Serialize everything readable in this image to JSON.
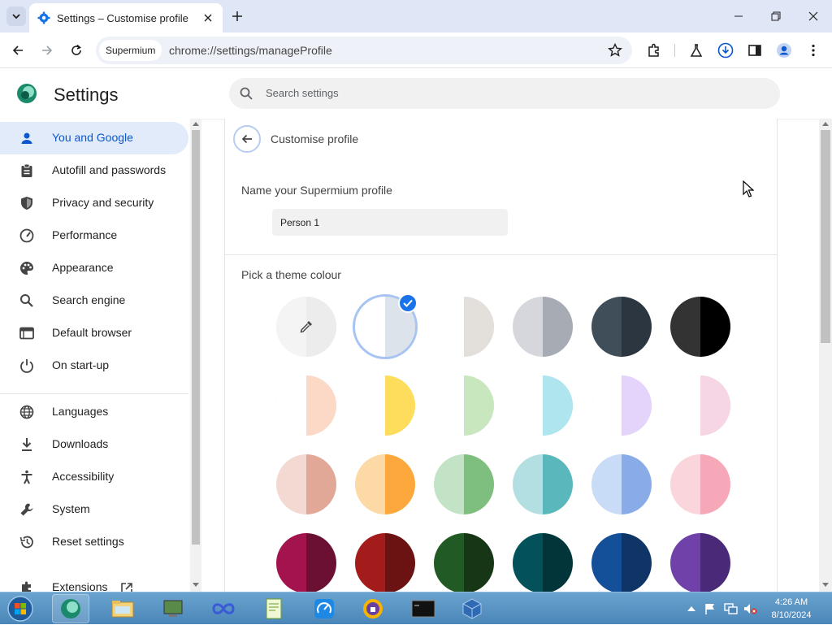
{
  "browser": {
    "tab": {
      "title": "Settings – Customise profile"
    },
    "omnibox": {
      "chip": "Supermium",
      "url": "chrome://settings/manageProfile"
    }
  },
  "header": {
    "title": "Settings",
    "search_placeholder": "Search settings"
  },
  "sidebar": {
    "items": [
      {
        "label": "You and Google",
        "icon": "person-icon",
        "active": true
      },
      {
        "label": "Autofill and passwords",
        "icon": "clipboard-icon"
      },
      {
        "label": "Privacy and security",
        "icon": "shield-icon"
      },
      {
        "label": "Performance",
        "icon": "speedometer-icon"
      },
      {
        "label": "Appearance",
        "icon": "palette-icon"
      },
      {
        "label": "Search engine",
        "icon": "search-icon"
      },
      {
        "label": "Default browser",
        "icon": "browser-icon"
      },
      {
        "label": "On start-up",
        "icon": "power-icon"
      },
      {
        "label": "Languages",
        "icon": "globe-icon"
      },
      {
        "label": "Downloads",
        "icon": "download-icon"
      },
      {
        "label": "Accessibility",
        "icon": "accessibility-icon"
      },
      {
        "label": "System",
        "icon": "wrench-icon"
      },
      {
        "label": "Reset settings",
        "icon": "history-icon"
      },
      {
        "label": "Extensions",
        "icon": "puzzle-icon"
      }
    ]
  },
  "page": {
    "title": "Customise profile",
    "name_label": "Name your Supermium profile",
    "name_value": "Person 1",
    "theme_label": "Pick a theme colour",
    "selected_swatch": 1,
    "swatches": [
      {
        "l": "#f4f4f4",
        "r": "#ececec",
        "light": true,
        "picker": true
      },
      {
        "l": "#ffffff",
        "r": "#dde3ea",
        "light": true
      },
      {
        "l": "#ffffff",
        "r": "#e3dfda",
        "light": true
      },
      {
        "l": "#d5d7dc",
        "r": "#a7abb3"
      },
      {
        "l": "#3f4e59",
        "r": "#2c3640"
      },
      {
        "l": "#333333",
        "r": "#000000"
      },
      {
        "l": "#ffffff",
        "r": "#fcd9c6",
        "light": true
      },
      {
        "l": "#ffffff",
        "r": "#fedd5c",
        "light": true
      },
      {
        "l": "#ffffff",
        "r": "#c9e7be",
        "light": true
      },
      {
        "l": "#ffffff",
        "r": "#aee5ef",
        "light": true
      },
      {
        "l": "#ffffff",
        "r": "#e4d4fb",
        "light": true
      },
      {
        "l": "#ffffff",
        "r": "#f6d5e5",
        "light": true
      },
      {
        "l": "#f4d9d2",
        "r": "#e1a898"
      },
      {
        "l": "#fdd9a6",
        "r": "#fda83c"
      },
      {
        "l": "#c3e3c6",
        "r": "#7ebe7e"
      },
      {
        "l": "#b4dfe2",
        "r": "#5ab8bd"
      },
      {
        "l": "#c8dbf7",
        "r": "#89ace8"
      },
      {
        "l": "#fad5dc",
        "r": "#f7a8b8"
      },
      {
        "l": "#a3134e",
        "r": "#6b0f33"
      },
      {
        "l": "#a41b1b",
        "r": "#6b1212"
      },
      {
        "l": "#225a25",
        "r": "#173616"
      },
      {
        "l": "#03525b",
        "r": "#023539"
      },
      {
        "l": "#144f9a",
        "r": "#0f3466"
      },
      {
        "l": "#7042a9",
        "r": "#4a2a78"
      }
    ]
  },
  "taskbar": {
    "time": "4:26 AM",
    "date": "8/10/2024"
  },
  "colors": {
    "accent": "#0b57d0",
    "active_bg": "#e2ebfa",
    "check": "#1a73e8"
  }
}
